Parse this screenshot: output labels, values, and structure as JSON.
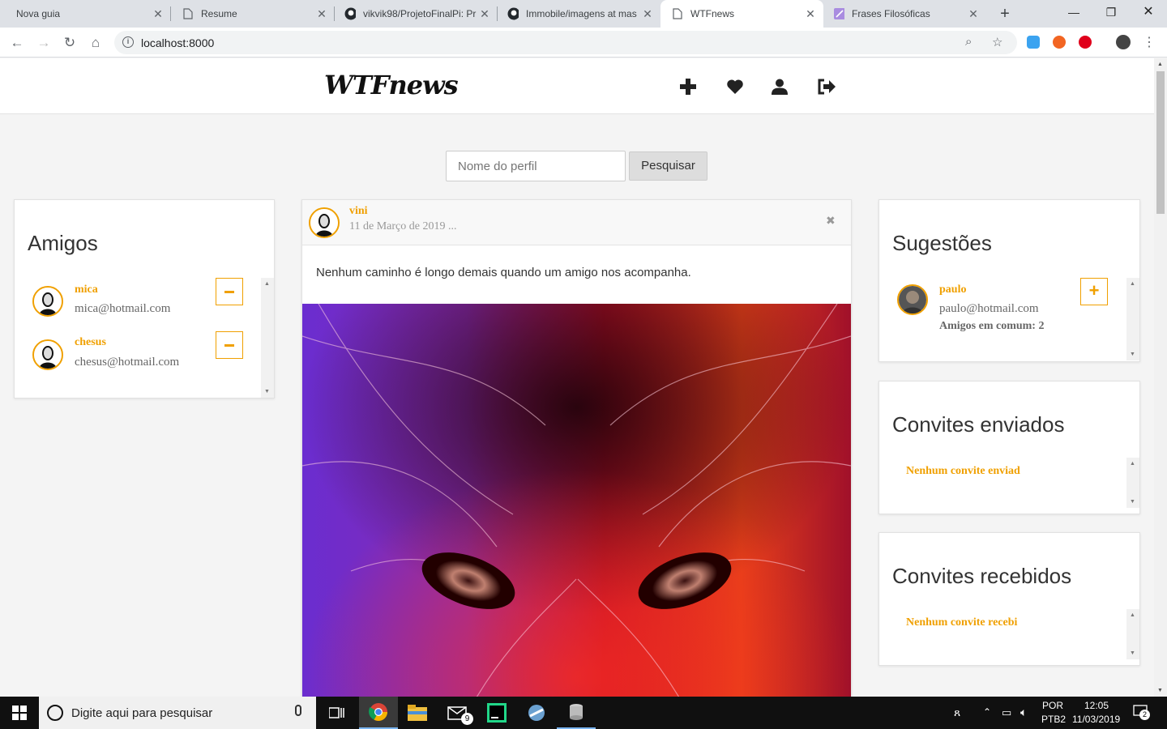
{
  "browser": {
    "tabs": [
      {
        "label": "Nova guia",
        "icon": "none"
      },
      {
        "label": "Resume",
        "icon": "document-icon"
      },
      {
        "label": "vikvik98/ProjetoFinalPi: Pr",
        "icon": "github-icon"
      },
      {
        "label": "Immobile/imagens at mas",
        "icon": "github-icon"
      },
      {
        "label": "WTFnews",
        "icon": "document-icon"
      },
      {
        "label": "Frases Filosóficas",
        "icon": "feather-icon"
      }
    ],
    "active_tab": 4,
    "url": "localhost:8000"
  },
  "header": {
    "logo": "WTFnews",
    "nav_icons": [
      "plus-icon",
      "heart-icon",
      "user-icon",
      "logout-icon"
    ]
  },
  "search": {
    "placeholder": "Nome do perfil",
    "button": "Pesquisar"
  },
  "friends": {
    "title": "Amigos",
    "items": [
      {
        "name": "mica",
        "email": "mica@hotmail.com",
        "action": "−"
      },
      {
        "name": "chesus",
        "email": "chesus@hotmail.com",
        "action": "−"
      }
    ]
  },
  "post": {
    "author": "vini",
    "date": "11 de Março de 2019 ...",
    "text": "Nenhum caminho é longo demais quando um amigo nos acompanha.",
    "close": "✖"
  },
  "suggestions": {
    "title": "Sugestões",
    "items": [
      {
        "name": "paulo",
        "email": "paulo@hotmail.com",
        "mutual": "Amigos em comum: 2",
        "action": "+"
      }
    ]
  },
  "sent_invites": {
    "title": "Convites enviados",
    "empty": "Nenhum convite enviad"
  },
  "received_invites": {
    "title": "Convites recebidos",
    "empty": "Nenhum convite recebi"
  },
  "taskbar": {
    "search_placeholder": "Digite aqui para pesquisar",
    "mail_badge": "9",
    "lang1": "POR",
    "lang2": "PTB2",
    "time": "12:05",
    "date": "11/03/2019",
    "notif_count": "2"
  },
  "colors": {
    "accent": "#f0a000"
  }
}
